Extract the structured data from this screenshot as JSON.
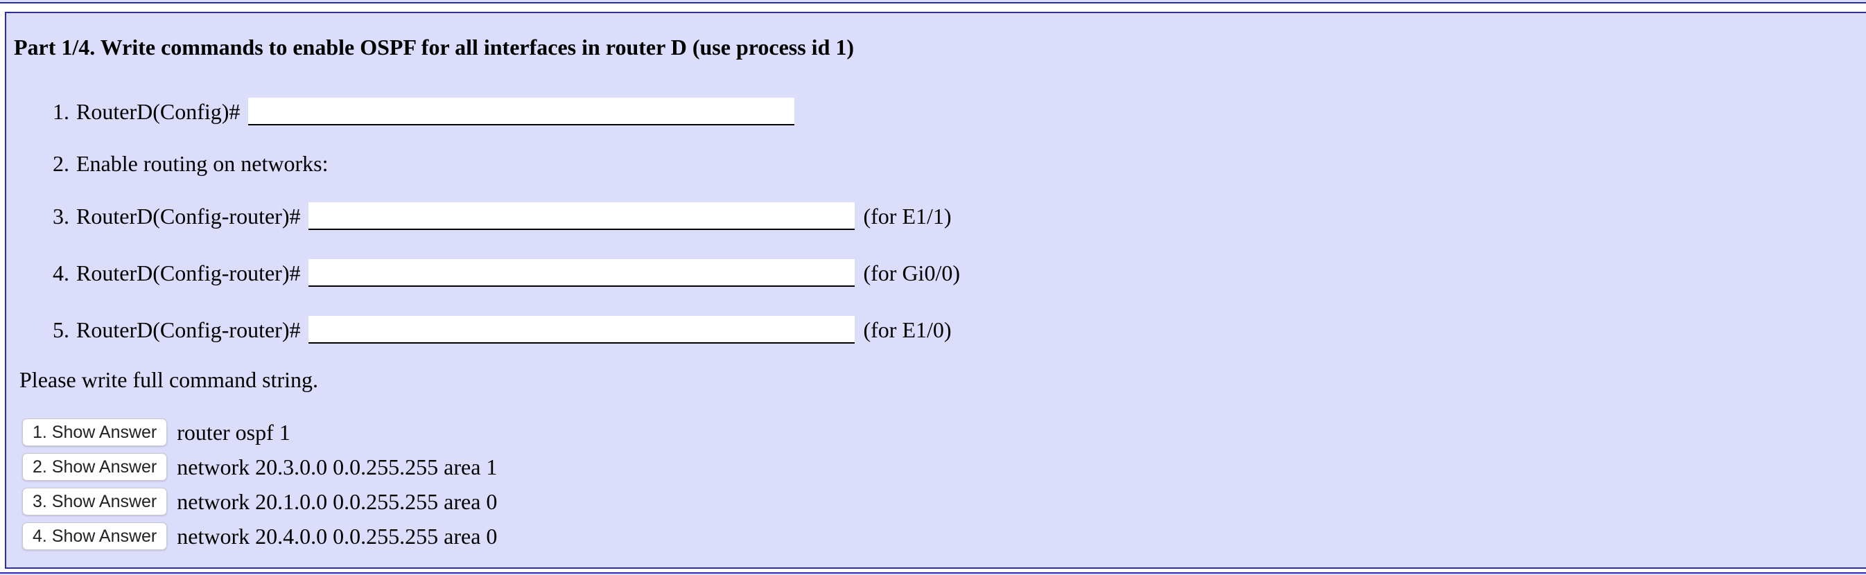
{
  "part": {
    "title": "Part 1/4. Write commands to enable OSPF for all interfaces in router D (use process id 1)"
  },
  "steps": [
    {
      "num": "1.",
      "prompt": "RouterD(Config)#",
      "value": "",
      "suffix": ""
    },
    {
      "num": "2.",
      "text": "Enable routing on networks:"
    },
    {
      "num": "3.",
      "prompt": "RouterD(Config-router)#",
      "value": "",
      "suffix": "(for E1/1)"
    },
    {
      "num": "4.",
      "prompt": "RouterD(Config-router)#",
      "value": "",
      "suffix": "(for Gi0/0)"
    },
    {
      "num": "5.",
      "prompt": "RouterD(Config-router)#",
      "value": "",
      "suffix": "(for E1/0)"
    }
  ],
  "note": "Please write full command string.",
  "answers": [
    {
      "button": "1. Show Answer",
      "text": "router ospf 1"
    },
    {
      "button": "2. Show Answer",
      "text": "network 20.3.0.0 0.0.255.255 area 1"
    },
    {
      "button": "3. Show Answer",
      "text": "network 20.1.0.0 0.0.255.255 area 0"
    },
    {
      "button": "4. Show Answer",
      "text": "network 20.4.0.0 0.0.255.255 area 0"
    }
  ],
  "colors": {
    "panel_background": "#dcdcfb",
    "panel_border": "#2b2bb8"
  }
}
